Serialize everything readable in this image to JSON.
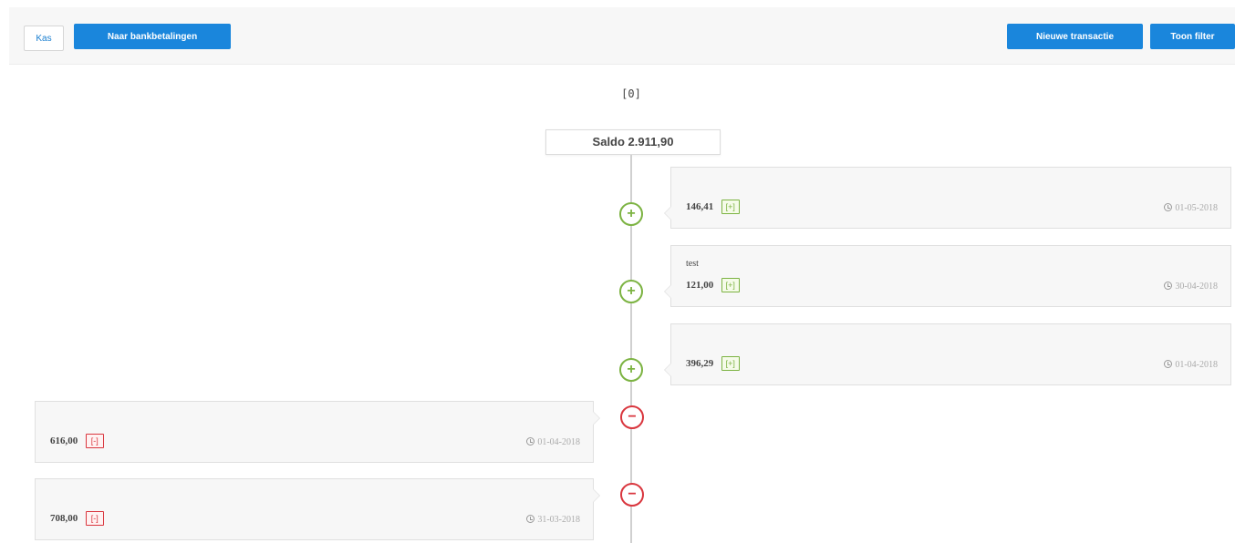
{
  "toolbar": {
    "kas_label": "Kas",
    "bank_label": "Naar bankbetalingen",
    "new_transaction_label": "Nieuwe transactie",
    "show_filter_label": "Toon filter"
  },
  "timeline": {
    "top_marker": "[0]",
    "saldo": "Saldo 2.911,90",
    "entries": [
      {
        "side": "right",
        "type": "plus",
        "amount": "146,41",
        "symbol": "[+]",
        "description": "",
        "date": "01-05-2018"
      },
      {
        "side": "right",
        "type": "plus",
        "amount": "121,00",
        "symbol": "[+]",
        "description": "test",
        "date": "30-04-2018"
      },
      {
        "side": "right",
        "type": "plus",
        "amount": "396,29",
        "symbol": "[+]",
        "description": "",
        "date": "01-04-2018"
      },
      {
        "side": "left",
        "type": "minus",
        "amount": "616,00",
        "symbol": "[-]",
        "description": "",
        "date": "01-04-2018"
      },
      {
        "side": "left",
        "type": "minus",
        "amount": "708,00",
        "symbol": "[-]",
        "description": "",
        "date": "31-03-2018"
      }
    ],
    "node_plus_glyph": "+",
    "node_minus_glyph": "−"
  },
  "colors": {
    "primary": "#1a86dc",
    "plus": "#7cb342",
    "minus": "#d9363e"
  },
  "icons": {
    "node_plus": "plus-circle-icon",
    "node_minus": "minus-circle-icon",
    "date": "clock-icon"
  }
}
